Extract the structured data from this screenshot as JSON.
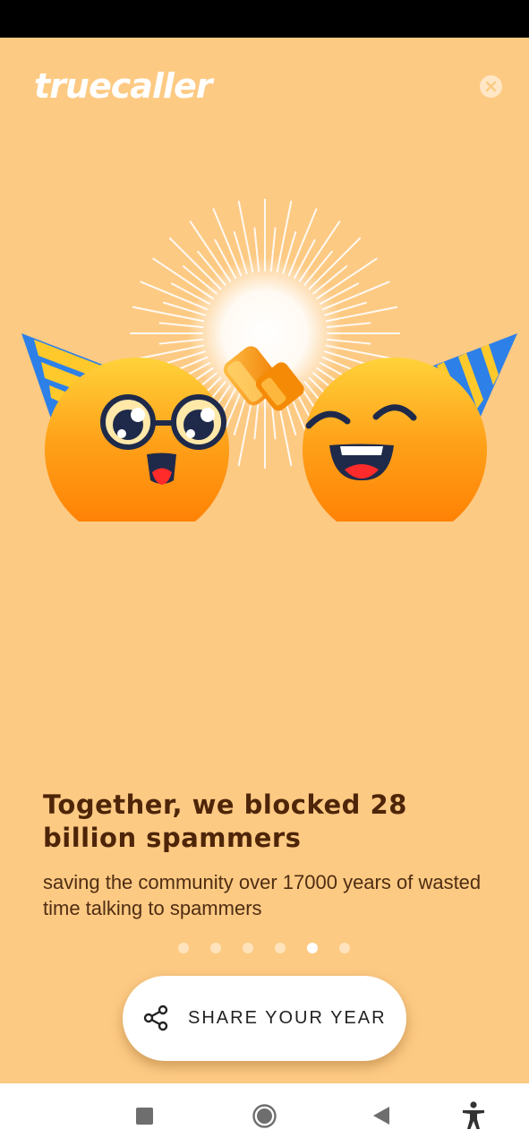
{
  "app": {
    "logo_text": "truecaller",
    "close_icon": "close-icon"
  },
  "slide": {
    "headline": "Together, we blocked 28 billion spammers",
    "subtext": "saving the community over 17000 years of wasted time talking to spammers",
    "total_pages": 6,
    "current_page": 5
  },
  "share_button": {
    "label": "SHARE YOUR YEAR",
    "icon": "share-icon"
  },
  "colors": {
    "background": "#FDCA84",
    "headline": "#4E2508",
    "emoji_orange": "#FF9A16",
    "hat_blue": "#2D80E8",
    "hat_yellow": "#FFC92B"
  },
  "navigation": {
    "recents_icon": "square-icon",
    "home_icon": "circle-icon",
    "back_icon": "triangle-back-icon",
    "accessibility_icon": "accessibility-icon"
  }
}
